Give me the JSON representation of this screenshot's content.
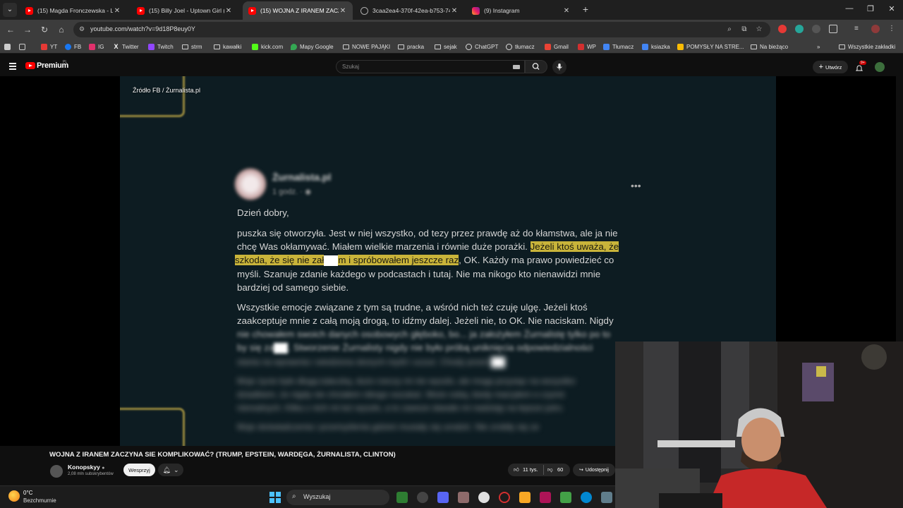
{
  "browser": {
    "tabs": [
      {
        "title": "(15) Magda Fronczewska - Lale",
        "icon": "youtube-icon"
      },
      {
        "title": "(15) Billy Joel - Uptown Girl (Off",
        "icon": "youtube-icon"
      },
      {
        "title": "(15) WOJNA Z IRANEM ZACZYNA",
        "icon": "youtube-icon",
        "active": true
      },
      {
        "title": "3caa2ea4-370f-42ea-b753-74b",
        "icon": "globe-icon"
      },
      {
        "title": "(9) Instagram",
        "icon": "instagram-icon"
      }
    ],
    "url": "youtube.com/watch?v=9d18P8euy0Y",
    "bookmarks": [
      {
        "label": "YT",
        "icon": "youtube-icon"
      },
      {
        "label": "FB",
        "icon": "facebook-icon"
      },
      {
        "label": "IG",
        "icon": "instagram-icon"
      },
      {
        "label": "Twitter",
        "icon": "x-icon"
      },
      {
        "label": "Twitch",
        "icon": "twitch-icon"
      },
      {
        "label": "strm",
        "icon": "folder-icon"
      },
      {
        "label": "kawałki",
        "icon": "folder-icon"
      },
      {
        "label": "kick.com",
        "icon": "kick-icon"
      },
      {
        "label": "Mapy Google",
        "icon": "maps-icon"
      },
      {
        "label": "NOWE PAJĄKI",
        "icon": "folder-icon"
      },
      {
        "label": "pracka",
        "icon": "folder-icon"
      },
      {
        "label": "sejak",
        "icon": "folder-icon"
      },
      {
        "label": "ChatGPT",
        "icon": "chatgpt-icon"
      },
      {
        "label": "tłumacz",
        "icon": "translate-icon"
      },
      {
        "label": "Gmail",
        "icon": "gmail-icon"
      },
      {
        "label": "WP",
        "icon": "wp-icon"
      },
      {
        "label": "Tłumacz",
        "icon": "translate-icon"
      },
      {
        "label": "ksiazka",
        "icon": "book-icon"
      },
      {
        "label": "POMYSŁY NA STRE...",
        "icon": "ideas-icon"
      },
      {
        "label": "Na bieżąco",
        "icon": "folder-icon"
      }
    ],
    "all_bookmarks": "Wszystkie zakładki"
  },
  "youtube": {
    "brand": "Premium",
    "region": "PL",
    "search_placeholder": "Szukaj",
    "create_label": "Utwórz",
    "notifications": "9+"
  },
  "video": {
    "source_label": "Źródło FB / Żurnalista.pl",
    "post": {
      "author": "Żurnalista.pl",
      "time": "1 godz. · ",
      "greeting": "Dzień dobry,",
      "p1_line1": "puszka się otworzyła. Jest w niej wszystko, od tezy przez prawdę aż do kłamstwa, ale ja nie",
      "p1_line2a": "chcę Was okłamywać. Miałem wielkie marzenia i równie duże porażki. ",
      "p1_line2b_hl": "Jeżeli ktoś uważa, że",
      "p1_line3a_hl": "szkoda, że się nie zał",
      "p1_line3b_hl": "m i spróbowałem jeszcze raz",
      "p1_line3c": ", OK. Każdy ma prawo powiedzieć co",
      "p1_line4": "myśli. Szanuje zdanie każdego w podcastach i tutaj. Nie ma nikogo kto nienawidzi mnie",
      "p1_line5": "bardziej od samego siebie.",
      "p2_line1": "Wszystkie emocje związane z tym są trudne, a wśród nich też czuję ulgę. Jeżeli ktoś",
      "p2_line2": "zaakceptuje mnie z całą moją drogą, to idźmy dalej. Jeżeli nie, to OK. Nie naciskam. Nigdy",
      "p2_line3": "nie chowałem swoich danych osobowych głęboko, bo... ja założyłem Żurnalistę tylko po to",
      "p2_line4a": "by się za",
      "p2_line4b": ". Stworzenie Żurnalisty nigdy nie było próbą uniknięcia odpowiedzialności",
      "p2_line5a": "stania na wprawnia i wiedziona skorych myśli i uczuć. Chody przed ",
      "p3_line1": "Moje życie było długą tułaczką, dużo rzeczy mi nie wyszło, ale mogę przysiąc na wszystko",
      "p3_line2": "dziadkiem, że nigdy nie chciałem nikogo oszukać. Może sobą, kiedy marzyłem o czymś",
      "p3_line3": "nierealnych. Kilka z nich mi też wyszło, a to zawsze dawało mi nadzieję na lepsze jutro.",
      "p4_line1": "Moje doświadczenia i przemyślenia gdzieś musiały się urodzić. Nie zrobiły się ze",
      "p4_line2": "mnie ogólnie gdy chce by go czytało. W dobrym i złym jak ten dzień"
    },
    "title": "WOJNA Z IRANEM ZACZYNA SIE KOMPLIKOWAĆ? (TRUMP, EPSTEIN, WARDĘGA, ŻURNALISTA, CLINTON)",
    "channel": "Konopskyy",
    "subscribers": "2,08 mln subskrybentów",
    "support_label": "Wesprzyj",
    "likes": "11 tys.",
    "dislikes": "60",
    "share_label": "Udostępnij"
  },
  "taskbar": {
    "temperature": "0°C",
    "weather": "Bezchmurnie",
    "search_label": "Wyszukaj"
  },
  "colors": {
    "highlight": "#c9b43a",
    "youtube_red": "#ff0000",
    "video_bg": "#0d1c22"
  }
}
